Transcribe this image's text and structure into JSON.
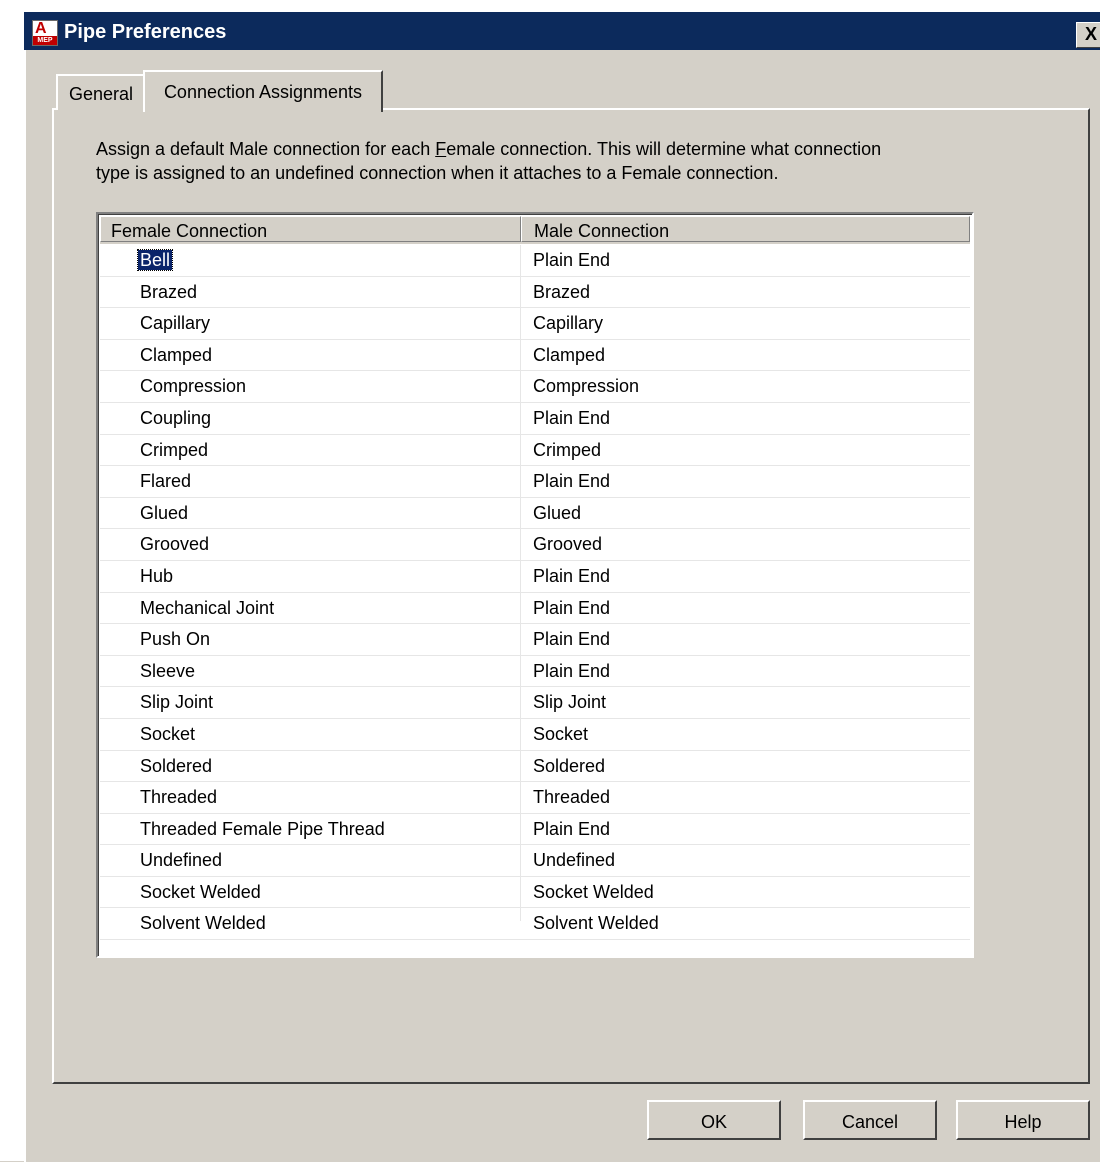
{
  "window": {
    "title": "Pipe Preferences",
    "close_label": "X",
    "icon_name": "autocad-mep-icon",
    "icon_letter": "A",
    "icon_badge": "MEP"
  },
  "tabs": [
    {
      "label": "General",
      "active": false
    },
    {
      "label": "Connection Assignments",
      "active": true
    }
  ],
  "description": {
    "line1_before": "Assign a default Male connection for each ",
    "line1_accel": "F",
    "line1_after": "emale connection. This will determine what connection",
    "line2": "type is assigned to an undefined connection when it attaches to a Female connection."
  },
  "table": {
    "headers": {
      "female": "Female Connection",
      "male": "Male Connection"
    },
    "rows": [
      {
        "female": "Bell",
        "male": "Plain End",
        "selected": true
      },
      {
        "female": "Brazed",
        "male": "Brazed"
      },
      {
        "female": "Capillary",
        "male": "Capillary"
      },
      {
        "female": "Clamped",
        "male": "Clamped"
      },
      {
        "female": "Compression",
        "male": "Compression"
      },
      {
        "female": "Coupling",
        "male": "Plain End"
      },
      {
        "female": "Crimped",
        "male": "Crimped"
      },
      {
        "female": "Flared",
        "male": "Plain End"
      },
      {
        "female": "Glued",
        "male": "Glued"
      },
      {
        "female": "Grooved",
        "male": "Grooved"
      },
      {
        "female": "Hub",
        "male": "Plain End"
      },
      {
        "female": "Mechanical Joint",
        "male": "Plain End"
      },
      {
        "female": "Push On",
        "male": "Plain End"
      },
      {
        "female": "Sleeve",
        "male": "Plain End"
      },
      {
        "female": "Slip Joint",
        "male": "Slip Joint"
      },
      {
        "female": "Socket",
        "male": "Socket"
      },
      {
        "female": "Soldered",
        "male": "Soldered"
      },
      {
        "female": "Threaded",
        "male": "Threaded"
      },
      {
        "female": "Threaded Female Pipe Thread",
        "male": "Plain End"
      },
      {
        "female": "Undefined",
        "male": "Undefined"
      },
      {
        "female": "Socket Welded",
        "male": "Socket Welded"
      },
      {
        "female": "Solvent Welded",
        "male": "Solvent Welded"
      }
    ]
  },
  "buttons": {
    "ok": "OK",
    "cancel": "Cancel",
    "help": "Help"
  },
  "colors": {
    "titlebar": "#0c2a5c",
    "selection": "#0a246a",
    "dialog_bg": "#d4d0c8"
  }
}
